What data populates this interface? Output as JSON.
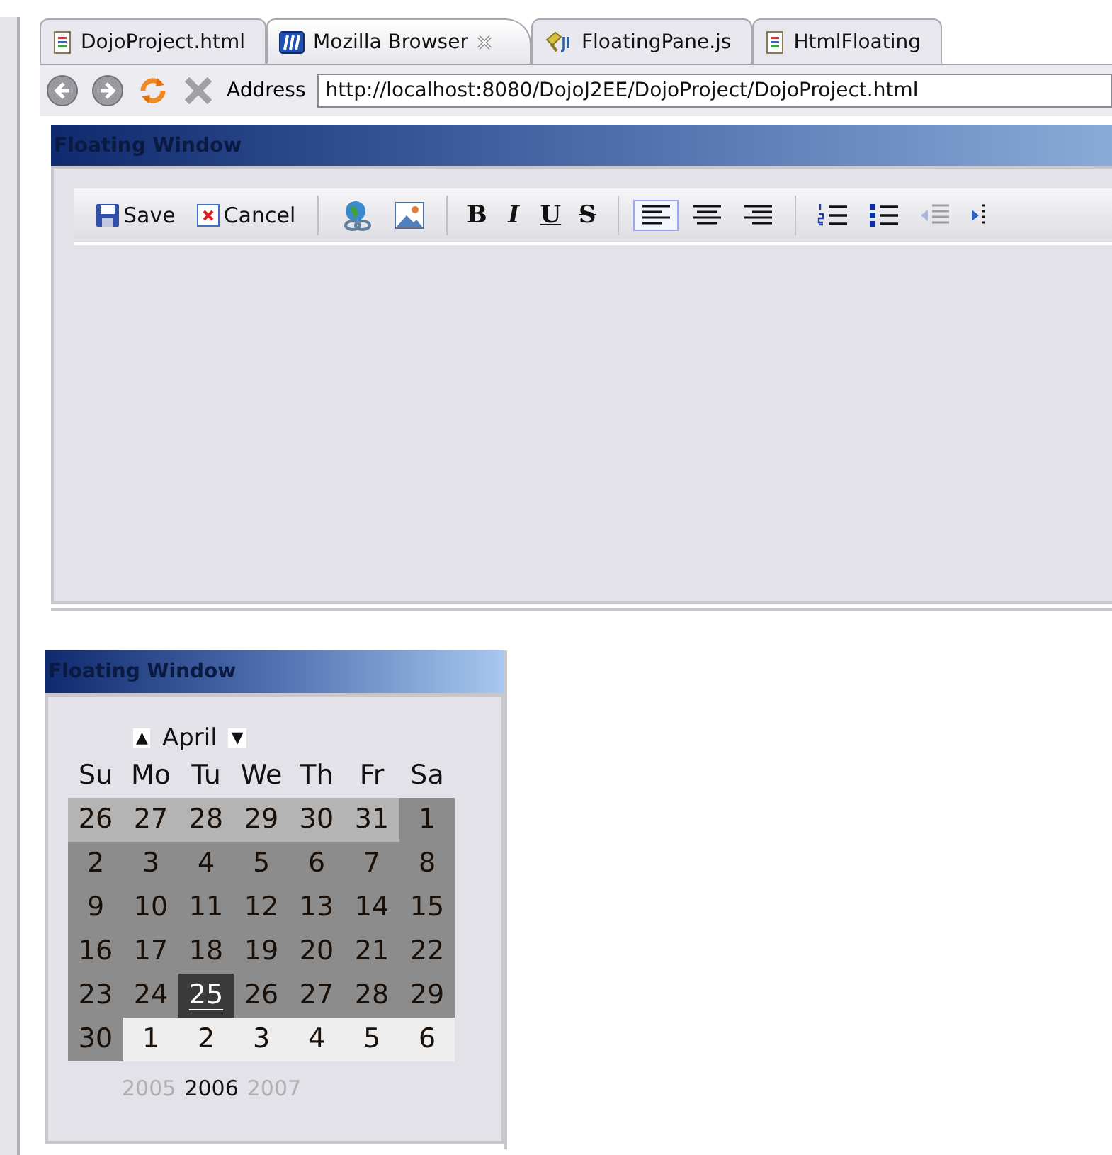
{
  "tabs": [
    {
      "label": "DojoProject.html",
      "kind": "html",
      "selected": false
    },
    {
      "label": "Mozilla Browser",
      "kind": "browser",
      "selected": true
    },
    {
      "label": "FloatingPane.js",
      "kind": "js",
      "selected": false
    },
    {
      "label": "HtmlFloating",
      "kind": "html",
      "selected": false
    }
  ],
  "address": {
    "label": "Address",
    "value": "http://localhost:8080/DojoJ2EE/DojoProject/DojoProject.html"
  },
  "editor_window": {
    "title": "Floating Window",
    "toolbar": [
      {
        "kind": "save",
        "label": "Save",
        "disabled": false,
        "selected": false
      },
      {
        "kind": "cancel",
        "label": "Cancel",
        "disabled": false,
        "selected": false
      },
      {
        "kind": "sep"
      },
      {
        "kind": "link",
        "disabled": false,
        "selected": false
      },
      {
        "kind": "image",
        "disabled": false,
        "selected": false
      },
      {
        "kind": "sep"
      },
      {
        "kind": "bold",
        "label": "B",
        "disabled": false,
        "selected": false
      },
      {
        "kind": "italic",
        "label": "I",
        "disabled": false,
        "selected": false
      },
      {
        "kind": "underline",
        "label": "U",
        "disabled": false,
        "selected": false
      },
      {
        "kind": "strike",
        "label": "S",
        "disabled": false,
        "selected": false
      },
      {
        "kind": "sep"
      },
      {
        "kind": "align-left",
        "disabled": false,
        "selected": true
      },
      {
        "kind": "align-center",
        "disabled": false,
        "selected": false
      },
      {
        "kind": "align-right",
        "disabled": false,
        "selected": false
      },
      {
        "kind": "sep"
      },
      {
        "kind": "ordered-list",
        "disabled": false,
        "selected": false
      },
      {
        "kind": "bullet-list",
        "disabled": false,
        "selected": false
      },
      {
        "kind": "outdent",
        "disabled": true,
        "selected": false
      },
      {
        "kind": "indent",
        "disabled": false,
        "selected": false
      }
    ]
  },
  "calendar_window": {
    "title": "Floating Window",
    "month": "April",
    "prev_month": "▲",
    "next_month": "▼",
    "weekdays": [
      "Su",
      "Mo",
      "Tu",
      "We",
      "Th",
      "Fr",
      "Sa"
    ],
    "days": [
      {
        "label": "26",
        "kind": "prev",
        "selected": false
      },
      {
        "label": "27",
        "kind": "prev",
        "selected": false
      },
      {
        "label": "28",
        "kind": "prev",
        "selected": false
      },
      {
        "label": "29",
        "kind": "prev",
        "selected": false
      },
      {
        "label": "30",
        "kind": "prev",
        "selected": false
      },
      {
        "label": "31",
        "kind": "prev",
        "selected": false
      },
      {
        "label": "1",
        "kind": "current",
        "selected": false
      },
      {
        "label": "2",
        "kind": "current",
        "selected": false
      },
      {
        "label": "3",
        "kind": "current",
        "selected": false
      },
      {
        "label": "4",
        "kind": "current",
        "selected": false
      },
      {
        "label": "5",
        "kind": "current",
        "selected": false
      },
      {
        "label": "6",
        "kind": "current",
        "selected": false
      },
      {
        "label": "7",
        "kind": "current",
        "selected": false
      },
      {
        "label": "8",
        "kind": "current",
        "selected": false
      },
      {
        "label": "9",
        "kind": "current",
        "selected": false
      },
      {
        "label": "10",
        "kind": "current",
        "selected": false
      },
      {
        "label": "11",
        "kind": "current",
        "selected": false
      },
      {
        "label": "12",
        "kind": "current",
        "selected": false
      },
      {
        "label": "13",
        "kind": "current",
        "selected": false
      },
      {
        "label": "14",
        "kind": "current",
        "selected": false
      },
      {
        "label": "15",
        "kind": "current",
        "selected": false
      },
      {
        "label": "16",
        "kind": "current",
        "selected": false
      },
      {
        "label": "17",
        "kind": "current",
        "selected": false
      },
      {
        "label": "18",
        "kind": "current",
        "selected": false
      },
      {
        "label": "19",
        "kind": "current",
        "selected": false
      },
      {
        "label": "20",
        "kind": "current",
        "selected": false
      },
      {
        "label": "21",
        "kind": "current",
        "selected": false
      },
      {
        "label": "22",
        "kind": "current",
        "selected": false
      },
      {
        "label": "23",
        "kind": "current",
        "selected": false
      },
      {
        "label": "24",
        "kind": "current",
        "selected": false
      },
      {
        "label": "25",
        "kind": "current",
        "selected": true
      },
      {
        "label": "26",
        "kind": "current",
        "selected": false
      },
      {
        "label": "27",
        "kind": "current",
        "selected": false
      },
      {
        "label": "28",
        "kind": "current",
        "selected": false
      },
      {
        "label": "29",
        "kind": "current",
        "selected": false
      },
      {
        "label": "30",
        "kind": "current",
        "selected": false
      },
      {
        "label": "1",
        "kind": "next",
        "selected": false
      },
      {
        "label": "2",
        "kind": "next",
        "selected": false
      },
      {
        "label": "3",
        "kind": "next",
        "selected": false
      },
      {
        "label": "4",
        "kind": "next",
        "selected": false
      },
      {
        "label": "5",
        "kind": "next",
        "selected": false
      },
      {
        "label": "6",
        "kind": "next",
        "selected": false
      }
    ],
    "years": [
      {
        "label": "2005",
        "selected": false
      },
      {
        "label": "2006",
        "selected": true
      },
      {
        "label": "2007",
        "selected": false
      }
    ]
  }
}
